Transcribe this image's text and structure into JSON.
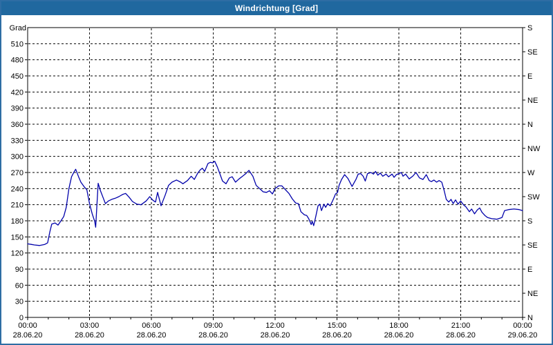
{
  "window": {
    "title": "Windrichtung [Grad]"
  },
  "colors": {
    "titlebar": "#20689f",
    "frame": "#2e6da4",
    "line": "#0000aa",
    "grid": "#000000",
    "plot_background": "#ffffff",
    "text": "#000000"
  },
  "chart_data": {
    "type": "line",
    "title": "Windrichtung [Grad]",
    "ylabel": "Grad",
    "ylim": [
      0,
      540
    ],
    "y_tick_values": [
      0,
      30,
      60,
      90,
      120,
      150,
      180,
      210,
      240,
      270,
      300,
      330,
      360,
      390,
      420,
      450,
      480,
      510
    ],
    "compass_ticks": [
      {
        "deg": 540,
        "label": "S"
      },
      {
        "deg": 495,
        "label": "SE"
      },
      {
        "deg": 450,
        "label": "E"
      },
      {
        "deg": 405,
        "label": "NE"
      },
      {
        "deg": 360,
        "label": "N"
      },
      {
        "deg": 315,
        "label": "NW"
      },
      {
        "deg": 270,
        "label": "W"
      },
      {
        "deg": 225,
        "label": "SW"
      },
      {
        "deg": 180,
        "label": "S"
      },
      {
        "deg": 135,
        "label": "SE"
      },
      {
        "deg": 90,
        "label": "E"
      },
      {
        "deg": 45,
        "label": "NE"
      },
      {
        "deg": 0,
        "label": "N"
      }
    ],
    "xlim_hours": [
      0,
      24
    ],
    "x_minor_tick_every_hours": 1,
    "x_ticks": [
      {
        "hour": 0,
        "time": "00:00",
        "date": "28.06.20"
      },
      {
        "hour": 3,
        "time": "03:00",
        "date": "28.06.20"
      },
      {
        "hour": 6,
        "time": "06:00",
        "date": "28.06.20"
      },
      {
        "hour": 9,
        "time": "09:00",
        "date": "28.06.20"
      },
      {
        "hour": 12,
        "time": "12:00",
        "date": "28.06.20"
      },
      {
        "hour": 15,
        "time": "15:00",
        "date": "28.06.20"
      },
      {
        "hour": 18,
        "time": "18:00",
        "date": "28.06.20"
      },
      {
        "hour": 21,
        "time": "21:00",
        "date": "28.06.20"
      },
      {
        "hour": 24,
        "time": "00:00",
        "date": "29.06.20"
      }
    ],
    "grid": true,
    "legend": "none",
    "series_name": "Windrichtung",
    "points": [
      [
        0.0,
        137
      ],
      [
        0.17,
        136
      ],
      [
        0.33,
        135
      ],
      [
        0.58,
        134
      ],
      [
        0.83,
        136
      ],
      [
        0.97,
        139
      ],
      [
        1.08,
        160
      ],
      [
        1.17,
        174
      ],
      [
        1.33,
        176
      ],
      [
        1.47,
        172
      ],
      [
        1.58,
        178
      ],
      [
        1.75,
        188
      ],
      [
        1.87,
        205
      ],
      [
        2.0,
        240
      ],
      [
        2.13,
        262
      ],
      [
        2.25,
        271
      ],
      [
        2.33,
        276
      ],
      [
        2.47,
        262
      ],
      [
        2.58,
        252
      ],
      [
        2.75,
        243
      ],
      [
        2.87,
        238
      ],
      [
        3.0,
        212
      ],
      [
        3.13,
        193
      ],
      [
        3.25,
        179
      ],
      [
        3.3,
        168
      ],
      [
        3.42,
        250
      ],
      [
        3.53,
        236
      ],
      [
        3.67,
        222
      ],
      [
        3.77,
        212
      ],
      [
        3.92,
        217
      ],
      [
        4.08,
        220
      ],
      [
        4.25,
        222
      ],
      [
        4.42,
        225
      ],
      [
        4.6,
        229
      ],
      [
        4.75,
        231
      ],
      [
        4.92,
        224
      ],
      [
        5.08,
        216
      ],
      [
        5.3,
        211
      ],
      [
        5.5,
        210
      ],
      [
        5.75,
        217
      ],
      [
        5.92,
        225
      ],
      [
        6.08,
        218
      ],
      [
        6.2,
        215
      ],
      [
        6.3,
        233
      ],
      [
        6.47,
        208
      ],
      [
        6.67,
        228
      ],
      [
        6.83,
        246
      ],
      [
        7.0,
        252
      ],
      [
        7.22,
        256
      ],
      [
        7.42,
        252
      ],
      [
        7.53,
        249
      ],
      [
        7.75,
        255
      ],
      [
        7.93,
        263
      ],
      [
        8.08,
        257
      ],
      [
        8.25,
        269
      ],
      [
        8.37,
        275
      ],
      [
        8.47,
        278
      ],
      [
        8.58,
        272
      ],
      [
        8.75,
        287
      ],
      [
        8.87,
        289
      ],
      [
        8.97,
        288
      ],
      [
        9.07,
        291
      ],
      [
        9.2,
        280
      ],
      [
        9.3,
        270
      ],
      [
        9.45,
        254
      ],
      [
        9.62,
        249
      ],
      [
        9.78,
        260
      ],
      [
        9.92,
        262
      ],
      [
        10.08,
        252
      ],
      [
        10.25,
        258
      ],
      [
        10.42,
        263
      ],
      [
        10.58,
        268
      ],
      [
        10.73,
        274
      ],
      [
        10.92,
        263
      ],
      [
        11.08,
        246
      ],
      [
        11.25,
        240
      ],
      [
        11.42,
        234
      ],
      [
        11.58,
        233
      ],
      [
        11.73,
        236
      ],
      [
        11.87,
        230
      ],
      [
        12.0,
        240
      ],
      [
        12.17,
        245
      ],
      [
        12.33,
        245
      ],
      [
        12.5,
        238
      ],
      [
        12.67,
        231
      ],
      [
        12.83,
        221
      ],
      [
        13.0,
        213
      ],
      [
        13.13,
        212
      ],
      [
        13.25,
        197
      ],
      [
        13.42,
        191
      ],
      [
        13.53,
        190
      ],
      [
        13.63,
        184
      ],
      [
        13.75,
        173
      ],
      [
        13.8,
        179
      ],
      [
        13.87,
        171
      ],
      [
        13.97,
        188
      ],
      [
        14.08,
        208
      ],
      [
        14.17,
        211
      ],
      [
        14.25,
        199
      ],
      [
        14.37,
        211
      ],
      [
        14.45,
        205
      ],
      [
        14.55,
        212
      ],
      [
        14.67,
        208
      ],
      [
        14.8,
        218
      ],
      [
        14.93,
        230
      ],
      [
        15.03,
        233
      ],
      [
        15.1,
        246
      ],
      [
        15.22,
        257
      ],
      [
        15.37,
        266
      ],
      [
        15.53,
        259
      ],
      [
        15.73,
        244
      ],
      [
        15.92,
        257
      ],
      [
        16.03,
        267
      ],
      [
        16.15,
        268
      ],
      [
        16.27,
        263
      ],
      [
        16.37,
        254
      ],
      [
        16.48,
        268
      ],
      [
        16.65,
        270
      ],
      [
        16.77,
        267
      ],
      [
        16.87,
        272
      ],
      [
        16.98,
        265
      ],
      [
        17.1,
        269
      ],
      [
        17.22,
        263
      ],
      [
        17.38,
        267
      ],
      [
        17.5,
        262
      ],
      [
        17.67,
        267
      ],
      [
        17.77,
        261
      ],
      [
        17.88,
        266
      ],
      [
        18.0,
        268
      ],
      [
        18.12,
        270
      ],
      [
        18.2,
        263
      ],
      [
        18.33,
        267
      ],
      [
        18.5,
        258
      ],
      [
        18.67,
        263
      ],
      [
        18.83,
        270
      ],
      [
        19.0,
        260
      ],
      [
        19.17,
        257
      ],
      [
        19.33,
        266
      ],
      [
        19.47,
        255
      ],
      [
        19.58,
        253
      ],
      [
        19.7,
        256
      ],
      [
        19.83,
        252
      ],
      [
        19.95,
        255
      ],
      [
        20.08,
        252
      ],
      [
        20.2,
        236
      ],
      [
        20.3,
        220
      ],
      [
        20.42,
        215
      ],
      [
        20.53,
        220
      ],
      [
        20.63,
        212
      ],
      [
        20.75,
        219
      ],
      [
        20.87,
        211
      ],
      [
        21.0,
        217
      ],
      [
        21.13,
        210
      ],
      [
        21.25,
        206
      ],
      [
        21.42,
        197
      ],
      [
        21.53,
        202
      ],
      [
        21.67,
        193
      ],
      [
        21.8,
        200
      ],
      [
        21.92,
        204
      ],
      [
        22.03,
        196
      ],
      [
        22.17,
        190
      ],
      [
        22.3,
        186
      ],
      [
        22.5,
        184
      ],
      [
        22.75,
        183
      ],
      [
        23.0,
        186
      ],
      [
        23.13,
        199
      ],
      [
        23.33,
        201
      ],
      [
        23.58,
        202
      ],
      [
        23.83,
        201
      ],
      [
        24.0,
        199
      ]
    ]
  }
}
